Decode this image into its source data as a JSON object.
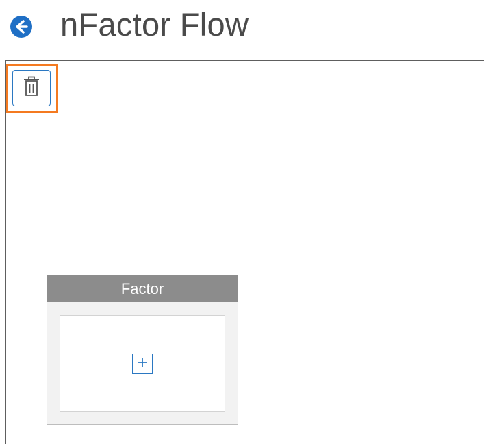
{
  "header": {
    "title": "nFactor Flow",
    "back_icon": "arrow-left-circle-icon",
    "back_icon_color": "#1f6fc5"
  },
  "toolbar": {
    "delete_icon": "trash-icon",
    "highlight_color": "#f47a20",
    "icon_color": "#2b78c2"
  },
  "factor_node": {
    "title": "Factor",
    "add_icon": "plus-icon",
    "header_color": "#8c8c8c"
  }
}
